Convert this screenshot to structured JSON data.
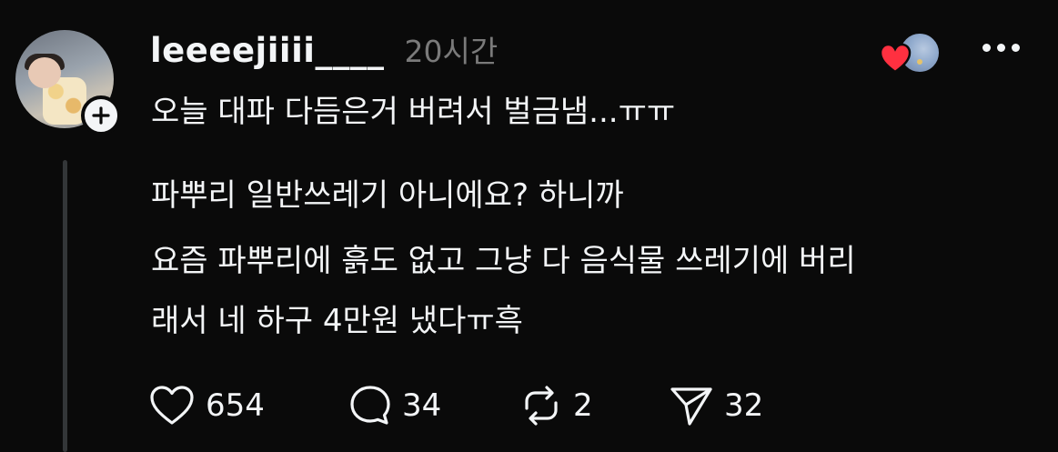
{
  "post": {
    "username": "leeeejiiii____",
    "timestamp": "20시간",
    "lines": [
      "오늘 대파 다듬은거 버려서 벌금냄...ㅠㅠ",
      "파뿌리 일반쓰레기 아니에요? 하니까",
      "요즘 파뿌리에 흙도 없고 그냥 다 음식물 쓰레기에 버리",
      "래서 네 하구 4만원 냈다ㅠ흑"
    ]
  },
  "actions": {
    "likes": "654",
    "replies": "34",
    "reposts": "2",
    "shares": "32"
  },
  "icons": {
    "like": "heart-outline-icon",
    "reply": "speech-bubble-icon",
    "repost": "repost-arrows-icon",
    "share": "paper-plane-icon",
    "more": "more-horizontal-icon",
    "follow": "plus-icon",
    "reacted": "red-heart-icon"
  },
  "colors": {
    "background": "#0a0a0a",
    "text": "#f3f5f7",
    "muted": "#7a7a7a",
    "heart": "#ff3040"
  }
}
